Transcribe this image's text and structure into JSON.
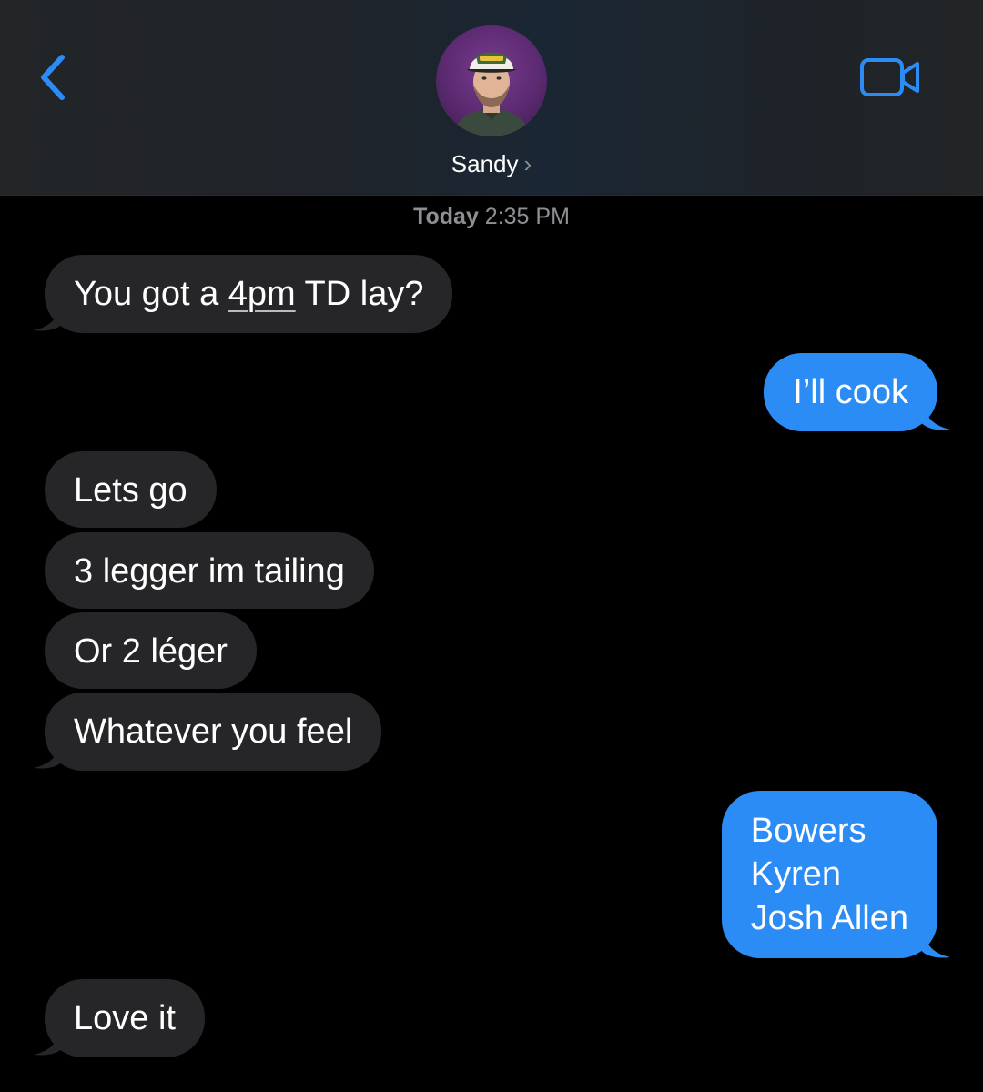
{
  "header": {
    "contact_name": "Sandy",
    "name_chevron": "›",
    "back_icon": "chevron-left-icon",
    "video_icon": "video-camera-icon",
    "accent_color": "#2b8cf6"
  },
  "timestamp": {
    "day": "Today",
    "time": "2:35 PM"
  },
  "messages": [
    {
      "sender": "them",
      "text_pre": "You got a ",
      "text_link": "4pm",
      "text_post": " TD lay?"
    },
    {
      "sender": "me",
      "text": "I’ll cook"
    },
    {
      "sender": "them",
      "text": "Lets go"
    },
    {
      "sender": "them",
      "text": "3 legger im tailing"
    },
    {
      "sender": "them",
      "text": "Or 2 léger"
    },
    {
      "sender": "them",
      "text": "Whatever you feel"
    },
    {
      "sender": "me",
      "lines": [
        "Bowers",
        "Kyren",
        "Josh Allen"
      ]
    },
    {
      "sender": "them",
      "text": "Love it"
    }
  ],
  "colors": {
    "incoming_bubble": "#262628",
    "outgoing_bubble": "#2b8cf6",
    "background": "#000000"
  }
}
